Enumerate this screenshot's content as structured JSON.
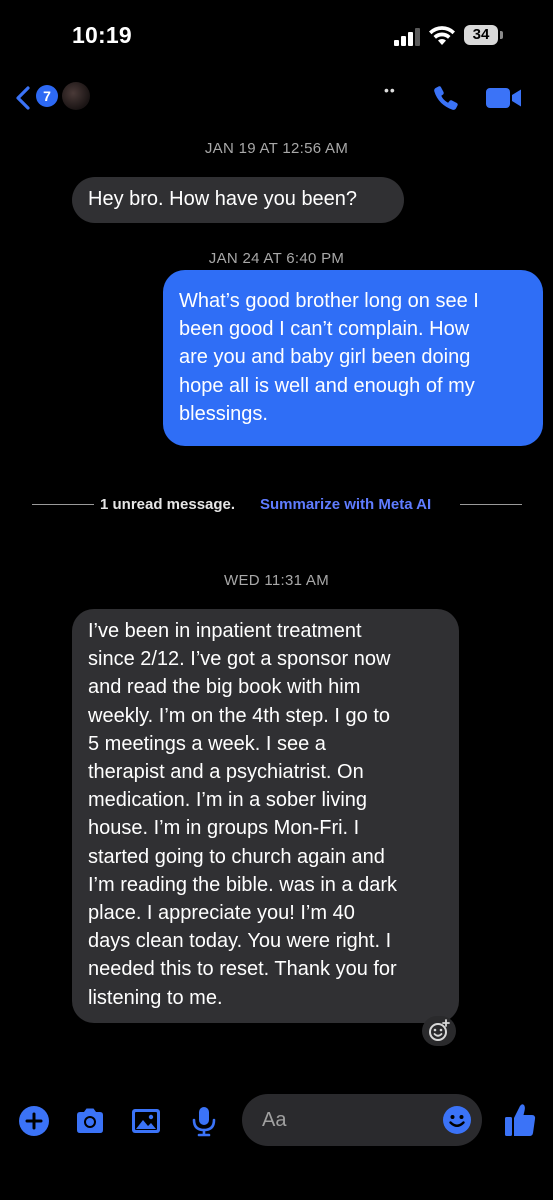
{
  "status_bar": {
    "time": "10:19",
    "battery": "34"
  },
  "nav": {
    "unread_count": "7",
    "more_indicator": "••"
  },
  "messages": [
    {
      "type": "timestamp",
      "text": "JAN 19 AT 12:56 AM"
    },
    {
      "type": "incoming",
      "text": "Hey bro. How have you been?"
    },
    {
      "type": "timestamp",
      "text": "JAN 24 AT 6:40 PM"
    },
    {
      "type": "outgoing",
      "text": "What’s good brother long on see I\nbeen good I can’t complain. How\nare you and baby girl been doing\nhope all is well and enough of my\nblessings."
    },
    {
      "type": "timestamp",
      "text": "WED 11:31 AM"
    },
    {
      "type": "incoming",
      "text": "I’ve been in inpatient treatment\nsince 2/12. I’ve got a sponsor now\nand read the big book with him\nweekly. I’m on the 4th step. I go to\n5 meetings a week. I see a\ntherapist and a psychiatrist. On\nmedication. I’m in a sober living\nhouse. I’m in groups Mon-Fri. I\nstarted going to church again and\nI’m reading the bible. was in a dark\nplace. I appreciate you! I’m 40\ndays clean today. You were right. I\nneeded this to reset. Thank you for\nlistening to me."
    }
  ],
  "unread_divider": {
    "text": "1 unread message.",
    "action": "Summarize with Meta AI"
  },
  "composer": {
    "placeholder": "Aa"
  },
  "colors": {
    "accent": "#2f6ef6",
    "incoming_bubble": "#303033",
    "meta_ai_link": "#5f7cff",
    "background": "#000000"
  },
  "icons": {
    "toolbar": [
      "plus-icon",
      "camera-icon",
      "image-icon",
      "microphone-icon"
    ],
    "nav": [
      "chevron-left-icon",
      "phone-icon",
      "video-camera-icon"
    ],
    "composer_right": [
      "emoji-icon",
      "thumbs-up-icon"
    ]
  }
}
